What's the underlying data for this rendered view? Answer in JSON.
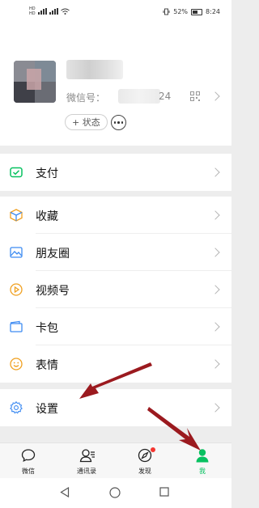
{
  "status_bar": {
    "battery": "52%",
    "time": "8:24",
    "sim1": "HD",
    "sim2": "HD"
  },
  "profile": {
    "wechat_id_label": "微信号：",
    "wechat_id_suffix": "24",
    "status_button": "+ 状态"
  },
  "menu": {
    "pay": "支付",
    "favorites": "收藏",
    "moments": "朋友圈",
    "channels": "视频号",
    "cards": "卡包",
    "stickers": "表情",
    "settings": "设置"
  },
  "tabs": [
    {
      "label": "微信"
    },
    {
      "label": "通讯录"
    },
    {
      "label": "发现"
    },
    {
      "label": "我"
    }
  ],
  "colors": {
    "accent": "#07c160",
    "arrow": "#9b1a1f",
    "badge": "#f43530"
  }
}
